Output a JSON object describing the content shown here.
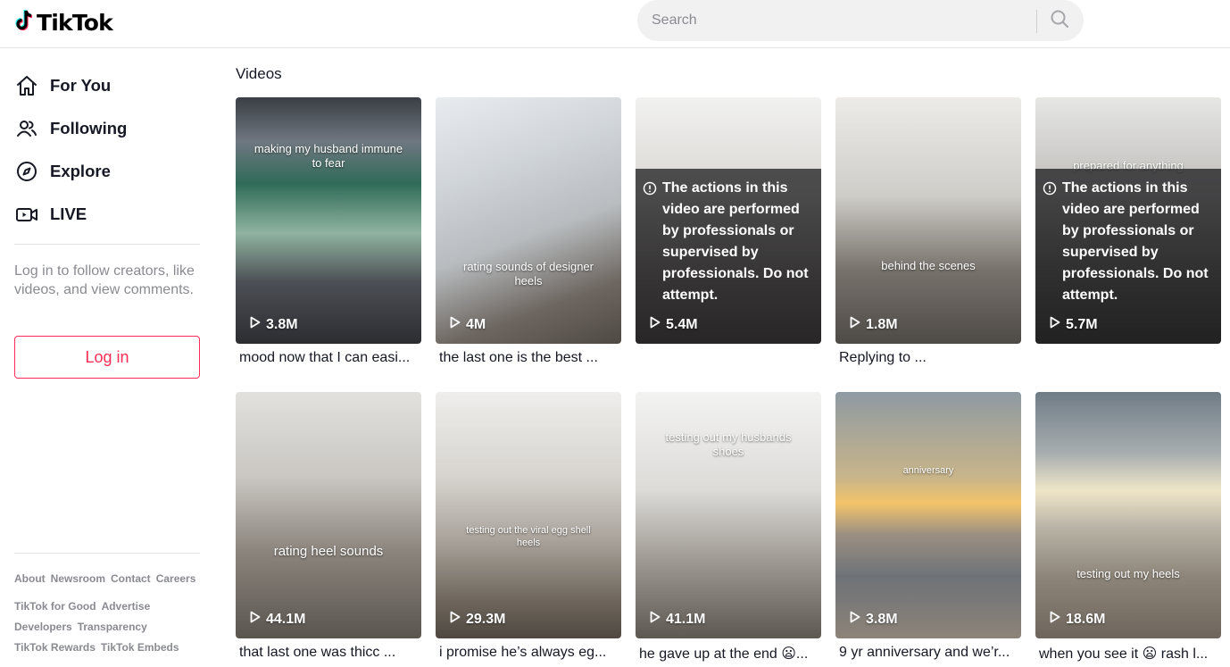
{
  "brand": {
    "name": "TikTok",
    "accent": "#fe2c55",
    "cyan": "#25f4ee"
  },
  "header": {
    "search_placeholder": "Search",
    "search_icon": "search-icon"
  },
  "sidebar": {
    "nav": [
      {
        "label": "For You",
        "icon": "home-icon"
      },
      {
        "label": "Following",
        "icon": "users-icon"
      },
      {
        "label": "Explore",
        "icon": "compass-icon"
      },
      {
        "label": "LIVE",
        "icon": "live-icon"
      }
    ],
    "login_prompt": "Log in to follow creators, like videos, and view comments.",
    "login_label": "Log in",
    "footer": [
      [
        "About",
        "Newsroom",
        "Contact",
        "Careers"
      ],
      [
        "TikTok for Good",
        "Advertise"
      ],
      [
        "Developers",
        "Transparency"
      ],
      [
        "TikTok Rewards",
        "TikTok Embeds"
      ]
    ]
  },
  "main": {
    "section_title": "Videos",
    "videos": [
      {
        "views": "3.8M",
        "caption": "mood now that I can easi...",
        "overlay": "making my husband immune to fear",
        "warning": ""
      },
      {
        "views": "4M",
        "caption": "the last one is the best ...",
        "overlay": "rating sounds of designer heels",
        "warning": ""
      },
      {
        "views": "5.4M",
        "caption": "",
        "overlay": "",
        "warning": "The actions in this video are performed by professionals or supervised by professionals. Do not attempt."
      },
      {
        "views": "1.8M",
        "caption": "Replying to ...",
        "overlay": "behind the scenes",
        "warning": ""
      },
      {
        "views": "5.7M",
        "caption": "",
        "overlay": "prepared for anything",
        "warning": "The actions in this video are performed by professionals or supervised by professionals. Do not attempt."
      },
      {
        "views": "44.1M",
        "caption": "that last one was thicc ...",
        "overlay": "rating heel sounds",
        "warning": ""
      },
      {
        "views": "29.3M",
        "caption": "i promise he’s always eg...",
        "overlay": "testing out the viral egg shell heels",
        "warning": ""
      },
      {
        "views": "41.1M",
        "caption": "he gave up at the end 😦...",
        "overlay": "testing out my husbands shoes",
        "warning": ""
      },
      {
        "views": "3.8M",
        "caption": "9 yr anniversary and we’r...",
        "overlay": "anniversary",
        "warning": ""
      },
      {
        "views": "18.6M",
        "caption": "when you see it 😦 rash l...",
        "overlay": "testing out my heels",
        "warning": ""
      }
    ]
  }
}
